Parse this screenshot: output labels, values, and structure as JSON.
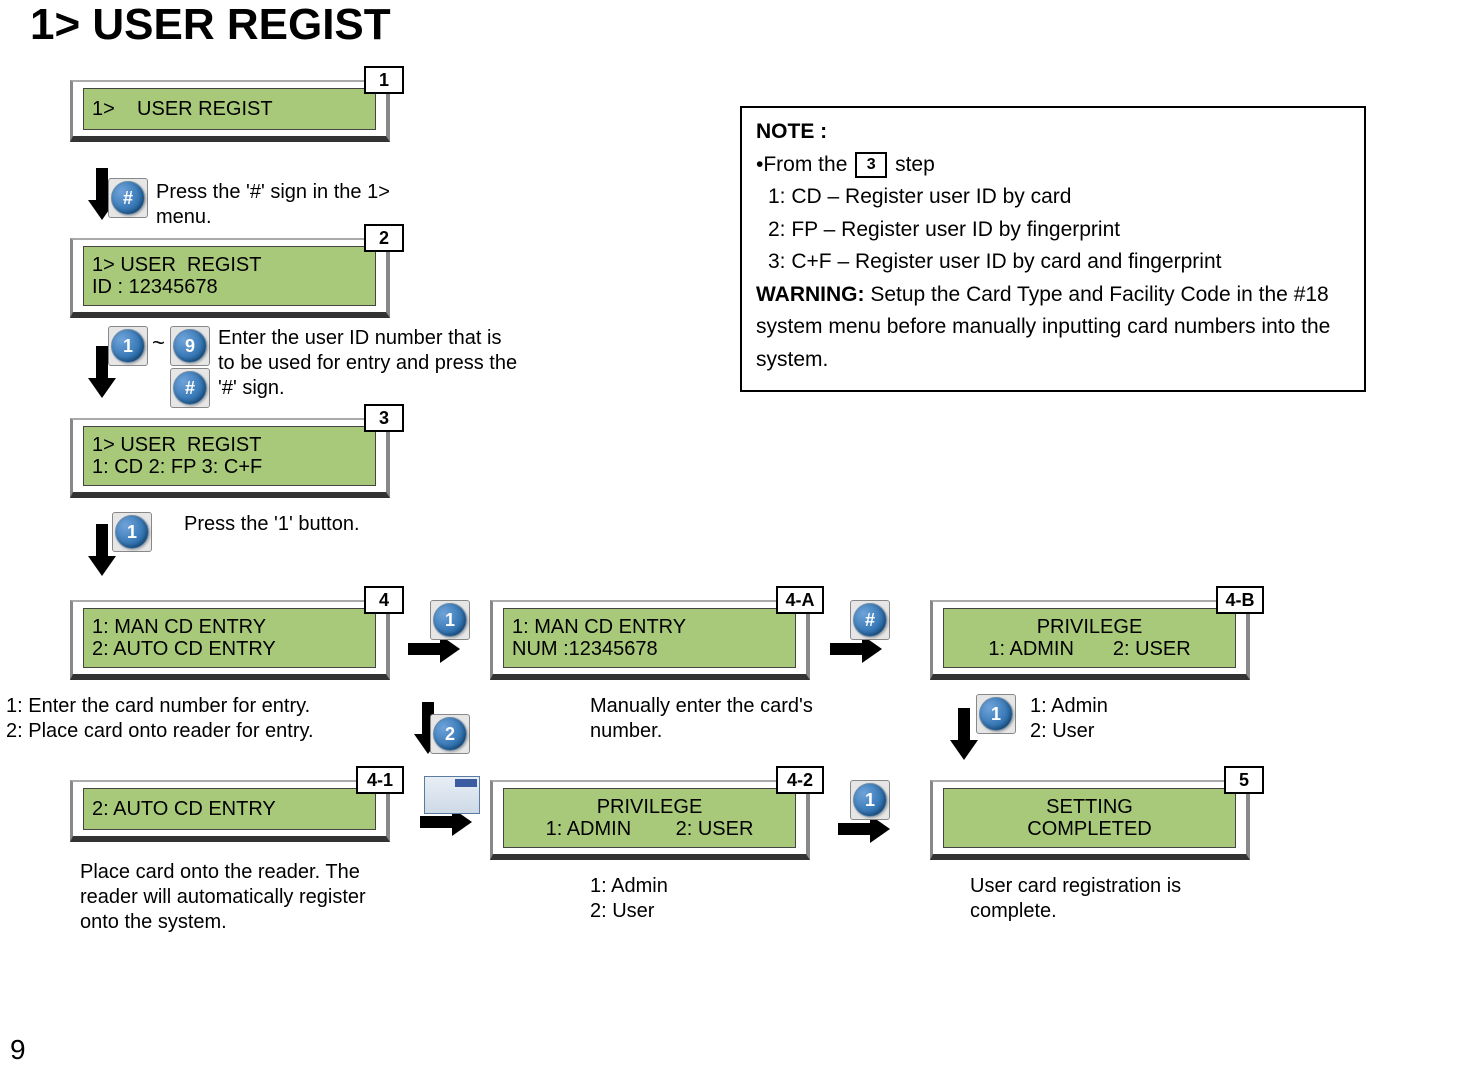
{
  "title": "1> USER REGIST",
  "page_number": "9",
  "steps": {
    "s1": {
      "badge": "1",
      "line1": "1>    USER REGIST"
    },
    "s2": {
      "badge": "2",
      "line1": "1> USER  REGIST",
      "line2": "ID : 12345678"
    },
    "s3": {
      "badge": "3",
      "line1": "1> USER  REGIST",
      "line2": "1: CD 2: FP 3: C+F"
    },
    "s4": {
      "badge": "4",
      "line1": "1: MAN CD ENTRY",
      "line2": "2: AUTO CD ENTRY"
    },
    "s4a": {
      "badge": "4-A",
      "line1": "1: MAN CD ENTRY",
      "line2": "NUM :12345678"
    },
    "s4b": {
      "badge": "4-B",
      "line1": "PRIVILEGE",
      "line2": "1: ADMIN       2: USER"
    },
    "s41": {
      "badge": "4-1",
      "line1": "2: AUTO CD ENTRY"
    },
    "s42": {
      "badge": "4-2",
      "line1": "PRIVILEGE",
      "line2": "1: ADMIN        2: USER"
    },
    "s5": {
      "badge": "5",
      "line1": "SETTING",
      "line2": "COMPLETED"
    }
  },
  "instructions": {
    "i1": "Press the '#' sign in the 1> menu.",
    "i2": "Enter the user ID number that is to be used for entry and press the '#' sign.",
    "i3": "Press the '1' button.",
    "i4": "1: Enter the card number for entry.\n2: Place card onto reader for entry.",
    "i4a": "Manually enter the card's number.",
    "i4b": "1: Admin\n2: User",
    "i41": "Place card onto the reader. The reader will automatically register onto the system.",
    "i42": "1: Admin\n2: User",
    "i5": "User card registration is complete."
  },
  "keys": {
    "hash": "#",
    "one": "1",
    "two": "2",
    "nine": "9",
    "tilde": "~"
  },
  "note": {
    "heading": "NOTE :",
    "from_prefix": "•From the ",
    "from_step": "3",
    "from_suffix": " step",
    "item1": "1: CD – Register user ID by card",
    "item2": "2: FP – Register user ID by fingerprint",
    "item3": "3: C+F – Register user ID by card and fingerprint",
    "warning_label": "WARNING:",
    "warning_text": " Setup the Card Type and Facility Code in the #18 system menu before manually inputting card numbers into the system."
  }
}
